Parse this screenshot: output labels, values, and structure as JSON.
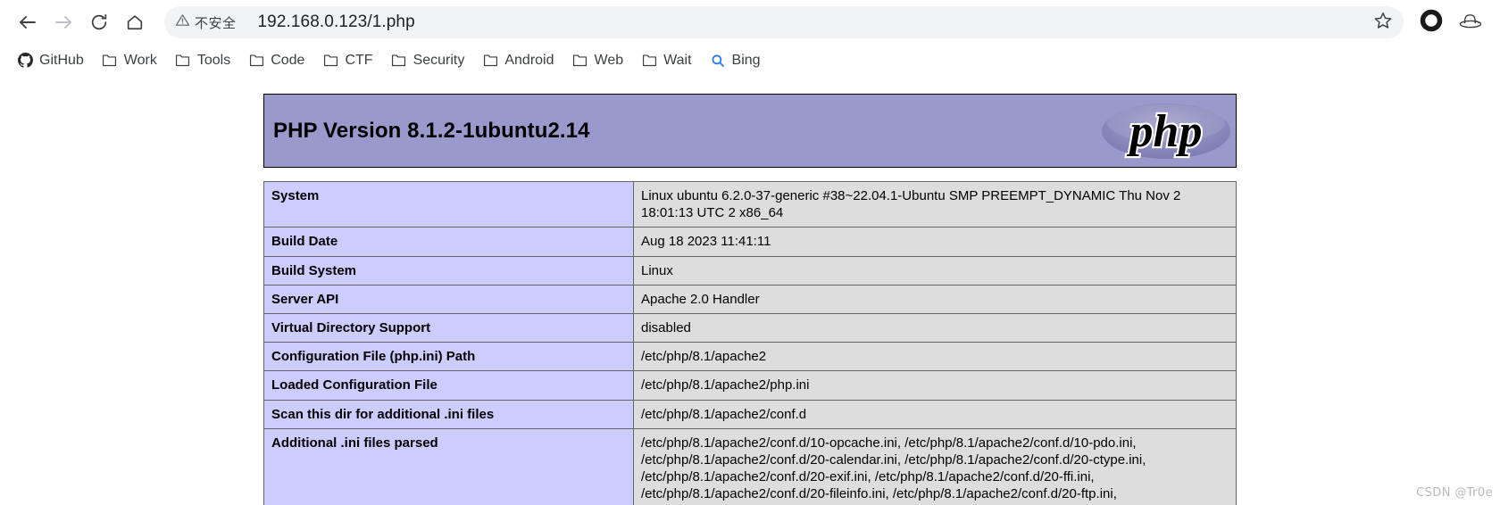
{
  "browser": {
    "nav": {
      "back_icon": "arrow-left-icon",
      "forward_icon": "arrow-right-icon",
      "reload_icon": "reload-icon",
      "home_icon": "home-icon"
    },
    "omnibox": {
      "security_icon": "warning-triangle-icon",
      "security_label": "不安全",
      "url": "192.168.0.123/1.php",
      "star_icon": "star-outline-icon"
    },
    "right_actions": [
      {
        "name": "profile-circle-icon",
        "icon": "circle-icon"
      },
      {
        "name": "extension-hat-icon",
        "icon": "hat-icon"
      }
    ],
    "bookmarks": [
      {
        "label": "GitHub",
        "icon": "github-icon"
      },
      {
        "label": "Work",
        "icon": "folder-icon"
      },
      {
        "label": "Tools",
        "icon": "folder-icon"
      },
      {
        "label": "Code",
        "icon": "folder-icon"
      },
      {
        "label": "CTF",
        "icon": "folder-icon"
      },
      {
        "label": "Security",
        "icon": "folder-icon"
      },
      {
        "label": "Android",
        "icon": "folder-icon"
      },
      {
        "label": "Web",
        "icon": "folder-icon"
      },
      {
        "label": "Wait",
        "icon": "folder-icon"
      },
      {
        "label": "Bing",
        "icon": "search-icon"
      }
    ]
  },
  "phpinfo": {
    "header": {
      "version_title": "PHP Version 8.1.2-1ubuntu2.14",
      "logo_text": "php",
      "background_color": "#9999cc"
    },
    "rows": [
      {
        "key": "System",
        "value": "Linux ubuntu 6.2.0-37-generic #38~22.04.1-Ubuntu SMP PREEMPT_DYNAMIC Thu Nov 2 18:01:13 UTC 2 x86_64"
      },
      {
        "key": "Build Date",
        "value": "Aug 18 2023 11:41:11"
      },
      {
        "key": "Build System",
        "value": "Linux"
      },
      {
        "key": "Server API",
        "value": "Apache 2.0 Handler"
      },
      {
        "key": "Virtual Directory Support",
        "value": "disabled"
      },
      {
        "key": "Configuration File (php.ini) Path",
        "value": "/etc/php/8.1/apache2"
      },
      {
        "key": "Loaded Configuration File",
        "value": "/etc/php/8.1/apache2/php.ini"
      },
      {
        "key": "Scan this dir for additional .ini files",
        "value": "/etc/php/8.1/apache2/conf.d"
      },
      {
        "key": "Additional .ini files parsed",
        "value": "/etc/php/8.1/apache2/conf.d/10-opcache.ini, /etc/php/8.1/apache2/conf.d/10-pdo.ini, /etc/php/8.1/apache2/conf.d/20-calendar.ini, /etc/php/8.1/apache2/conf.d/20-ctype.ini, /etc/php/8.1/apache2/conf.d/20-exif.ini, /etc/php/8.1/apache2/conf.d/20-ffi.ini, /etc/php/8.1/apache2/conf.d/20-fileinfo.ini, /etc/php/8.1/apache2/conf.d/20-ftp.ini,"
      }
    ],
    "colors": {
      "key_cell": "#ccccff",
      "value_cell": "#dddddd",
      "border": "#666666"
    }
  },
  "watermark": "CSDN @Tr0e"
}
